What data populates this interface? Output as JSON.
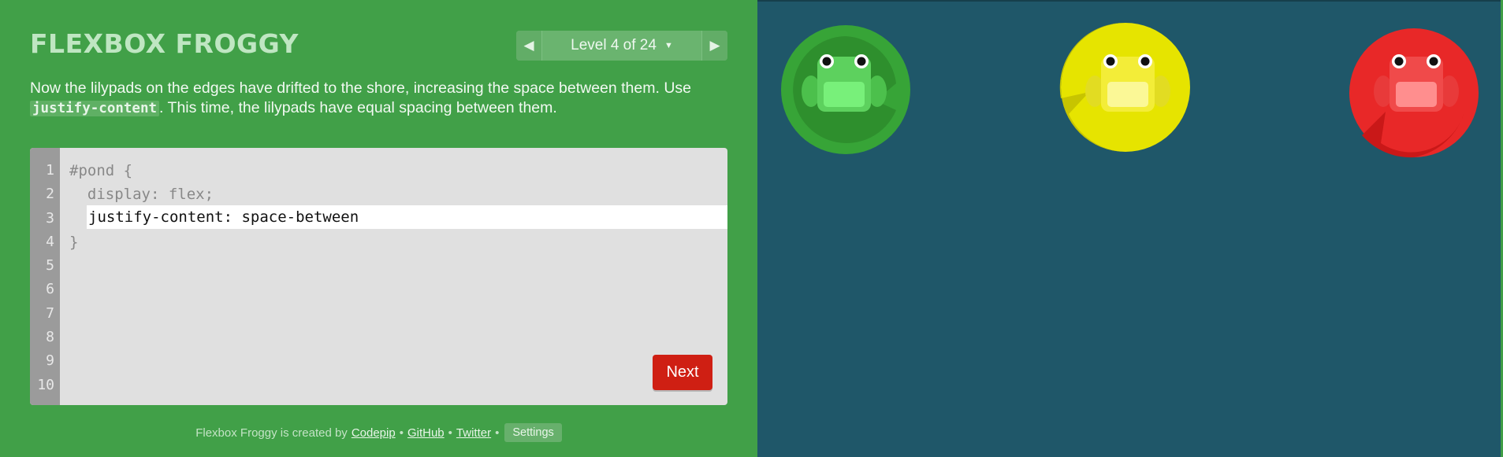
{
  "header": {
    "title": "FLEXBOX FROGGY",
    "level_label": "Level 4 of 24",
    "prev_icon": "triangle-left-icon",
    "next_icon": "triangle-right-icon",
    "dropdown_icon": "caret-down-icon"
  },
  "instructions": {
    "text_before": "Now the lilypads on the edges have drifted to the shore, increasing the space between them. Use ",
    "code_term": "justify-content",
    "text_after": ". This time, the lilypads have equal spacing between them."
  },
  "editor": {
    "line_numbers": [
      "1",
      "2",
      "3",
      "4",
      "5",
      "6",
      "7",
      "8",
      "9",
      "10"
    ],
    "line1": "#pond {",
    "line2": "  display: flex;",
    "input_value": "justify-content: space-between",
    "line4": "}",
    "next_label": "Next"
  },
  "footer": {
    "credit_text": "Flexbox Froggy is created by",
    "link_codepip": "Codepip",
    "link_github": "GitHub",
    "link_twitter": "Twitter",
    "separator": "•",
    "settings_label": "Settings"
  },
  "pond": {
    "frogs": [
      {
        "color": "green",
        "pad": "#2f8f2e",
        "body": "#5fd35f"
      },
      {
        "color": "yellow",
        "pad": "#c9c600",
        "body": "#f2ec34"
      },
      {
        "color": "red",
        "pad": "#d42020",
        "body": "#f04848"
      }
    ]
  },
  "colors": {
    "left_background": "#41a048",
    "pond_background": "#1f5769",
    "next_button": "#cf1f13",
    "editor_background": "#e0e0e0"
  }
}
